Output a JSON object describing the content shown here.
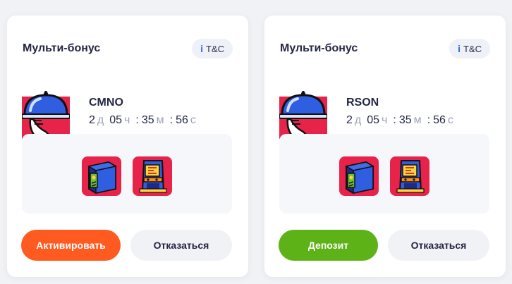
{
  "colors": {
    "activate": "#ff5a1f",
    "deposit": "#5cb216",
    "icon_red": "#e8234a",
    "icon_blue": "#2f5fe0"
  },
  "cards": [
    {
      "title": "Мульти-бонус",
      "tc": {
        "icon": "i",
        "label": "T&C"
      },
      "bonus_icon": "cloche-waiter-icon",
      "name": "CMNO",
      "timer": {
        "days": "2",
        "days_unit": "д",
        "hours": "05",
        "hours_unit": "ч",
        "minutes": "35",
        "minutes_unit": "м",
        "seconds": "56",
        "seconds_unit": "с",
        "sep": ":"
      },
      "games": [
        "blue-safe-game-icon",
        "arcade-machine-game-icon"
      ],
      "primary_button": "Активировать",
      "secondary_button": "Отказаться"
    },
    {
      "title": "Мульти-бонус",
      "tc": {
        "icon": "i",
        "label": "T&C"
      },
      "bonus_icon": "cloche-waiter-icon",
      "name": "RSON",
      "timer": {
        "days": "2",
        "days_unit": "д",
        "hours": "05",
        "hours_unit": "ч",
        "minutes": "35",
        "minutes_unit": "м",
        "seconds": "56",
        "seconds_unit": "с",
        "sep": ":"
      },
      "games": [
        "blue-safe-game-icon",
        "arcade-machine-game-icon"
      ],
      "primary_button": "Депозит",
      "secondary_button": "Отказаться"
    }
  ]
}
